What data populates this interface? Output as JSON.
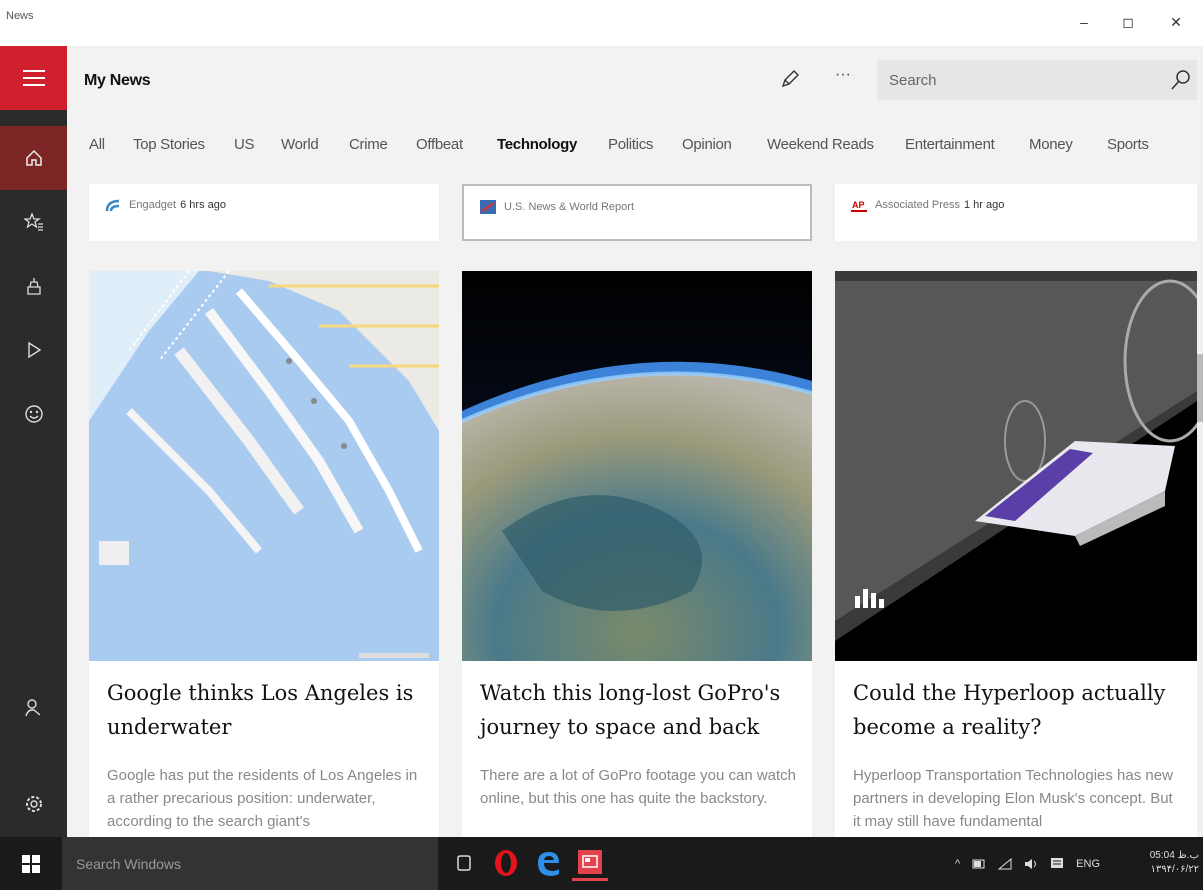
{
  "window": {
    "title": "News",
    "minimize": "–",
    "maximize": "◻",
    "close": "✕"
  },
  "rail": {
    "icons": [
      "home-icon",
      "favorites-icon",
      "local-icon",
      "video-icon",
      "interests-icon",
      "account-icon",
      "settings-icon"
    ]
  },
  "header": {
    "title": "My News",
    "more_label": "···",
    "search_placeholder": "Search"
  },
  "tabs": [
    {
      "label": "All"
    },
    {
      "label": "Top Stories"
    },
    {
      "label": "US"
    },
    {
      "label": "World"
    },
    {
      "label": "Crime"
    },
    {
      "label": "Offbeat"
    },
    {
      "label": "Technology",
      "active": true
    },
    {
      "label": "Politics"
    },
    {
      "label": "Opinion"
    },
    {
      "label": "Weekend Reads"
    },
    {
      "label": "Entertainment"
    },
    {
      "label": "Money"
    },
    {
      "label": "Sports"
    }
  ],
  "top_sources": [
    {
      "source": "Engadget",
      "time": "6 hrs ago"
    },
    {
      "source": "U.S. News & World Report",
      "time": ""
    },
    {
      "source": "Associated Press",
      "time": "1 hr ago"
    }
  ],
  "articles": [
    {
      "headline": "Google thinks Los Angeles is underwater",
      "snippet": "Google has put the residents of Los Angeles in a rather precarious position: underwater, according to the search giant's"
    },
    {
      "headline": "Watch this long-lost GoPro's journey to space and back",
      "snippet": "There are a lot of GoPro footage you can watch online, but this one has quite the backstory."
    },
    {
      "headline": "Could the Hyperloop actually become a reality?",
      "snippet": "Hyperloop Transportation Technologies has new partners in developing Elon Musk's concept. But it may still have fundamental"
    }
  ],
  "taskbar": {
    "search_placeholder": "Search Windows",
    "lang": "ENG",
    "time": "05:04 ب.ظ",
    "date": "۱۳۹۴/۰۶/۲۲"
  },
  "colors": {
    "accent": "#d0202d",
    "rail": "#2b2b2b",
    "rail_active": "#7c2626"
  }
}
